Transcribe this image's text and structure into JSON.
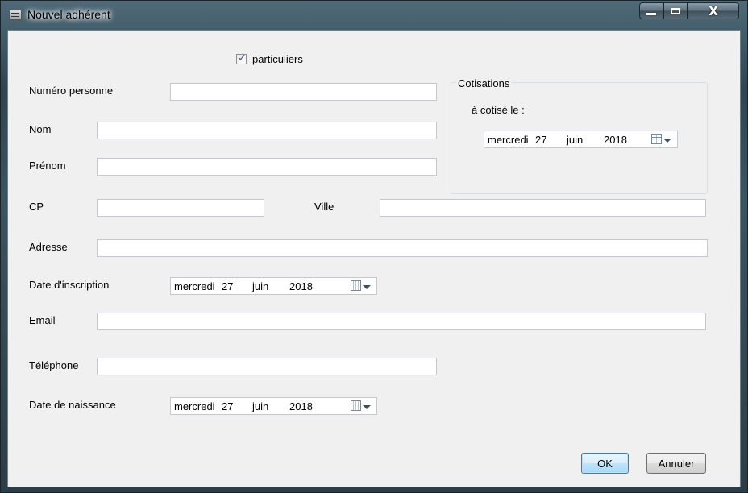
{
  "window": {
    "title": "Nouvel adhérent",
    "icons": {
      "app": "form-app-icon",
      "minimize": "minimize-icon",
      "maximize": "maximize-icon",
      "close": "close-icon"
    },
    "close_glyph": "X"
  },
  "form": {
    "particuliers": {
      "label": "particuliers",
      "checked": true,
      "check_glyph": "✓"
    },
    "numero_personne": {
      "label": "Numéro personne",
      "value": ""
    },
    "nom": {
      "label": "Nom",
      "value": ""
    },
    "prenom": {
      "label": "Prénom",
      "value": ""
    },
    "cp": {
      "label": "CP",
      "value": ""
    },
    "ville": {
      "label": "Ville",
      "value": ""
    },
    "adresse": {
      "label": "Adresse",
      "value": ""
    },
    "date_inscription": {
      "label": "Date d'inscription",
      "weekday": "mercredi",
      "day": "27",
      "month": "juin",
      "year": "2018"
    },
    "email": {
      "label": "Email",
      "value": ""
    },
    "telephone": {
      "label": "Téléphone",
      "value": ""
    },
    "date_naissance": {
      "label": "Date de naissance",
      "weekday": "mercredi",
      "day": "27",
      "month": "juin",
      "year": "2018"
    }
  },
  "cotisations": {
    "group_title": "Cotisations",
    "label": "à cotisé le :",
    "date": {
      "weekday": "mercredi",
      "day": "27",
      "month": "juin",
      "year": "2018"
    }
  },
  "buttons": {
    "ok": "OK",
    "annuler": "Annuler"
  }
}
